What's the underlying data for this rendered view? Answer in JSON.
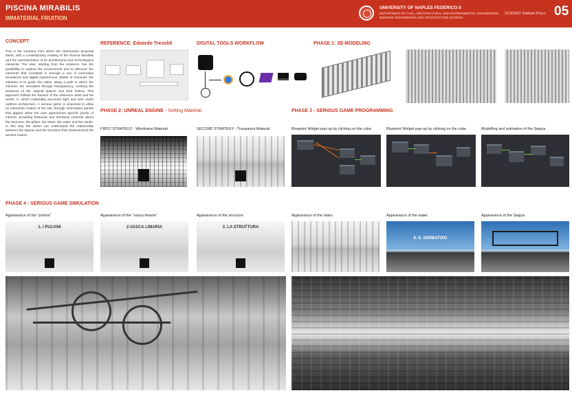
{
  "header": {
    "title": "PISCINA MIRABILIS",
    "subtitle": "IMMATERIAL FRUITION",
    "university": "UNIVERSITY OF NAPLES FEDERICO II",
    "department_line1": "DEPARTMENT OF CIVIL, ARCHITECTURAL AND ENVIRONMENTAL ENGINEERING",
    "department_line2": "BUILDING ENGINEERING AND ARCHITECTURE STUDIES",
    "student": "STUDENT: Raffaele Prisco",
    "page_number": "05"
  },
  "sections": {
    "concept": "CONCEPT",
    "reference": "REFERENCE: Edoardo Tresoldi",
    "digital_tools": "DIGITAL TOOLS WORKFLOW",
    "phase1": "PHASE 1: 3D MODELING",
    "phase2": "PHASE 2: UNREAL ENGINE",
    "phase2_sub": " - Setting Material",
    "phase3": "PHASE 3 - SERIOUS GAME PROGRAMMING",
    "phase4": "PHASE 4 - SERIOUS GAME SIMULATION"
  },
  "concept_text": "This is the scenario from which the intervention proposal starts, with a contemporary reading of the Piscina Mirabilis and the representation of its architectural and technological elements. The user, starting from the entrance, has the possibility to explore the environment and to discover the elements that constitute it, through a mix of immersive sensations and digital experiences. Matter is removed: the intention is to guide the visitor along a path in which the volumes are recreated through transparency, evoking the presence of the original spaces and their history. This approach follows the themes of the reference artist and his works, in which materiality becomes light and wire mesh outlines architecture. A serious game is proposed to allow an interactive fruition of the site, through information panels that appear when the user approaches specific points of interest, providing historical and technical contents about the structure, the pillars, the stairs, the water and the vaults. In this way the visitor can understand the relationship between the spaces and the functions that characterized the ancient cistern.",
  "captions": {
    "first_strategy": "FIRST STRATEGY - Wireframe Material",
    "second_strategy": "SECOND STRATEGY - Trasparent Material",
    "bp1": "Blueprint Widget pop-up by clicking on the cube",
    "bp2": "Blueprint Widget pop-up by clicking on the cube",
    "bp3": "Modelling and animation of the Saqiya",
    "s1": "Appearance of the \"pulvini\"",
    "s2": "Appearance of the \"vasca limaria\"",
    "s3": "Appearance of the structure",
    "s4": "Appearance of the stairs",
    "s5": "Appearance of the water",
    "s6": "Appearance of the Saqiya"
  },
  "sim_labels": {
    "s1": "1. I PULVINI",
    "s2": "2.VASCA LIMARIA",
    "s3": "3. LA STRUTTURA",
    "s5": "6. IL SERBATOIO"
  },
  "tools": [
    "Rhino",
    "Blender",
    "Unreal Engine",
    "Visual Studio",
    "Laptop",
    "VR Headset"
  ],
  "colors": {
    "accent": "#c8331f",
    "header_sub": "#f4d9a8"
  }
}
